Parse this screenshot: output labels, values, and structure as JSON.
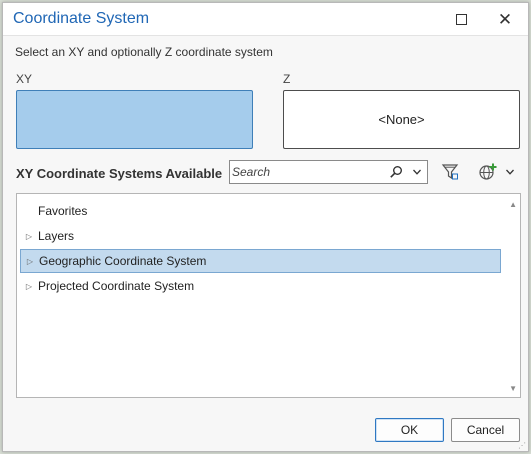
{
  "window": {
    "title": "Coordinate System"
  },
  "instruction": "Select an XY and optionally Z coordinate system",
  "xy": {
    "label": "XY",
    "value": ""
  },
  "z": {
    "label": "Z",
    "value": "<None>"
  },
  "available": {
    "heading": "XY Coordinate Systems Available",
    "search_placeholder": "Search"
  },
  "tree": {
    "items": [
      {
        "label": "Favorites",
        "expandable": false,
        "selected": false
      },
      {
        "label": "Layers",
        "expandable": true,
        "selected": false
      },
      {
        "label": "Geographic Coordinate System",
        "expandable": true,
        "selected": true
      },
      {
        "label": "Projected Coordinate System",
        "expandable": true,
        "selected": false
      }
    ]
  },
  "buttons": {
    "ok": "OK",
    "cancel": "Cancel"
  },
  "icons": {
    "maximize": "maximize-icon",
    "close": "close-icon",
    "search": "search-icon",
    "dropdown": "chevron-down-icon",
    "filter": "filter-icon",
    "add_globe": "add-globe-icon"
  },
  "colors": {
    "title": "#2067b5",
    "xy_fill": "#a5ccec",
    "selection": "#c3daee",
    "accent_border": "#2f78c2"
  }
}
